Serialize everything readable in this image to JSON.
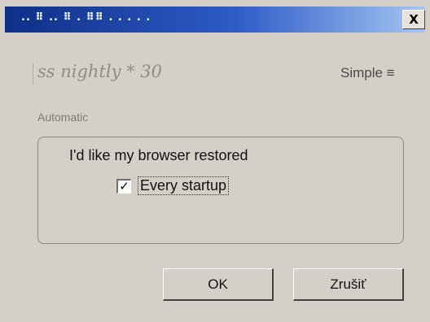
{
  "window": {
    "title": ".. ⠿ .. ⠿ . ⠿⠿ . . . . .",
    "close_label": "X"
  },
  "header": {
    "brand": "ss nightly  *  30",
    "mode": "Simple ≡"
  },
  "section": {
    "label": "Automatic"
  },
  "group": {
    "heading": "I'd like my browser restored",
    "checkbox": {
      "checked": true,
      "mark": "✓",
      "label": "Every startup"
    }
  },
  "buttons": {
    "ok": "OK",
    "cancel": "Zrušiť"
  }
}
